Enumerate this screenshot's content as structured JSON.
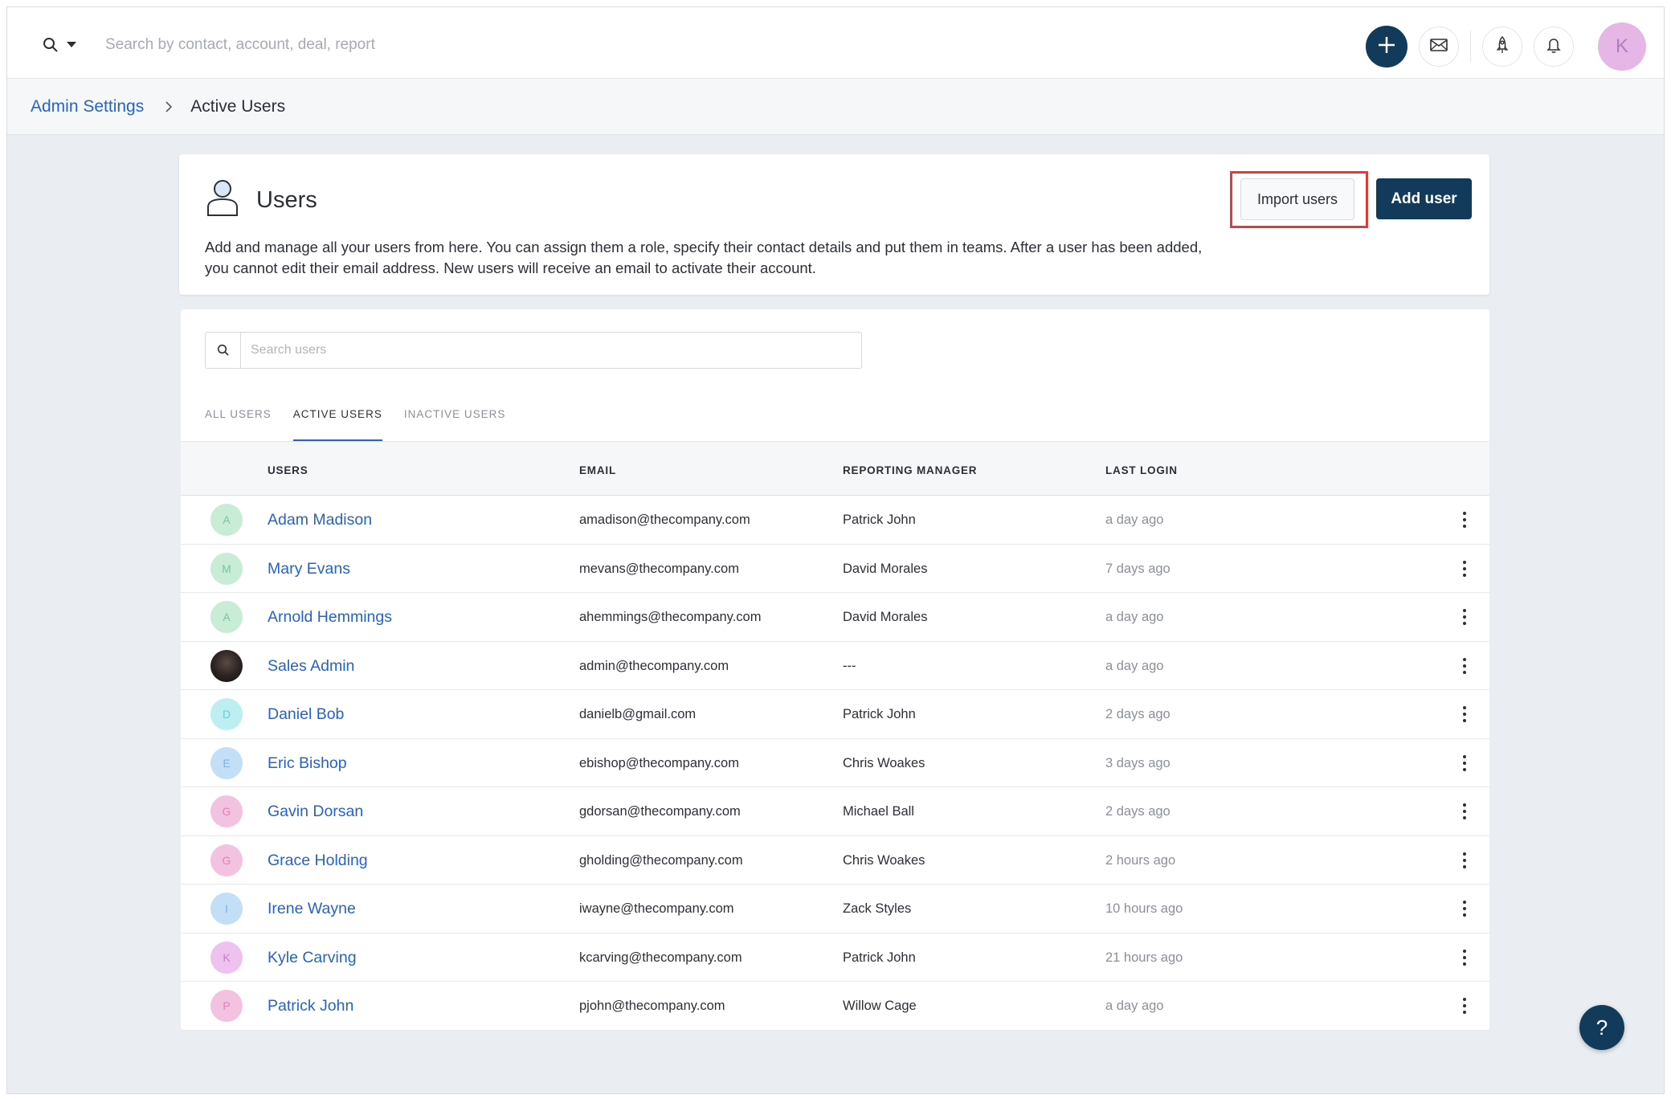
{
  "topbar": {
    "search_placeholder": "Search by contact, account, deal, report",
    "avatar_initial": "K",
    "icons": [
      "search-icon",
      "caret-down-icon",
      "plus-icon",
      "mail-icon",
      "rocket-icon",
      "bell-icon"
    ]
  },
  "breadcrumb": {
    "parent": "Admin Settings",
    "current": "Active Users"
  },
  "header": {
    "title": "Users",
    "description": "Add and manage all your users from here. You can assign them a role, specify their contact details and put them in teams. After a user has been added, you cannot edit their email address. New users will receive an email to activate their account.",
    "import_label": "Import users",
    "add_label": "Add user",
    "highlight_color": "#e53935"
  },
  "users_panel": {
    "search_placeholder": "Search users",
    "tabs": [
      {
        "label": "ALL USERS",
        "active": false
      },
      {
        "label": "ACTIVE USERS",
        "active": true
      },
      {
        "label": "INACTIVE USERS",
        "active": false
      }
    ],
    "columns": [
      "USERS",
      "EMAIL",
      "REPORTING MANAGER",
      "LAST LOGIN"
    ],
    "rows": [
      {
        "initial": "A",
        "avatar_color": "#c9ecd6",
        "initial_color": "#7cc49a",
        "name": "Adam Madison",
        "email": "amadison@thecompany.com",
        "manager": "Patrick John",
        "last_login": "a day ago"
      },
      {
        "initial": "M",
        "avatar_color": "#c9ecd6",
        "initial_color": "#7cc49a",
        "name": "Mary Evans",
        "email": "mevans@thecompany.com",
        "manager": "David Morales",
        "last_login": "7 days ago"
      },
      {
        "initial": "A",
        "avatar_color": "#c9ecd6",
        "initial_color": "#7cc49a",
        "name": "Arnold Hemmings",
        "email": "ahemmings@thecompany.com",
        "manager": "David Morales",
        "last_login": "a day ago"
      },
      {
        "initial": "",
        "avatar_color": "#2a2a2a",
        "initial_color": "#2a2a2a",
        "name": "Sales Admin",
        "email": "admin@thecompany.com",
        "manager": "---",
        "last_login": "a day ago"
      },
      {
        "initial": "D",
        "avatar_color": "#bdeef2",
        "initial_color": "#6cc9d2",
        "name": "Daniel Bob",
        "email": "danielb@gmail.com",
        "manager": "Patrick John",
        "last_login": "2 days ago"
      },
      {
        "initial": "E",
        "avatar_color": "#c3def7",
        "initial_color": "#7fb2e0",
        "name": "Eric Bishop",
        "email": "ebishop@thecompany.com",
        "manager": "Chris Woakes",
        "last_login": "3 days ago"
      },
      {
        "initial": "G",
        "avatar_color": "#f3c2e0",
        "initial_color": "#d985b6",
        "name": "Gavin Dorsan",
        "email": "gdorsan@thecompany.com",
        "manager": "Michael Ball",
        "last_login": "2 days ago"
      },
      {
        "initial": "G",
        "avatar_color": "#f3c2e0",
        "initial_color": "#d985b6",
        "name": "Grace Holding",
        "email": "gholding@thecompany.com",
        "manager": "Chris Woakes",
        "last_login": "2 hours ago"
      },
      {
        "initial": "I",
        "avatar_color": "#c3def7",
        "initial_color": "#7fb2e0",
        "name": "Irene Wayne",
        "email": "iwayne@thecompany.com",
        "manager": "Zack Styles",
        "last_login": "10 hours ago"
      },
      {
        "initial": "K",
        "avatar_color": "#eec2ee",
        "initial_color": "#c27fc8",
        "name": "Kyle Carving",
        "email": "kcarving@thecompany.com",
        "manager": "Patrick John",
        "last_login": "21 hours ago"
      },
      {
        "initial": "P",
        "avatar_color": "#f3c2e0",
        "initial_color": "#d985b6",
        "name": "Patrick John",
        "email": "pjohn@thecompany.com",
        "manager": "Willow Cage",
        "last_login": "a day ago"
      }
    ]
  },
  "help": {
    "label": "?"
  },
  "colors": {
    "primary": "#123a5a",
    "link": "#2563c9"
  }
}
